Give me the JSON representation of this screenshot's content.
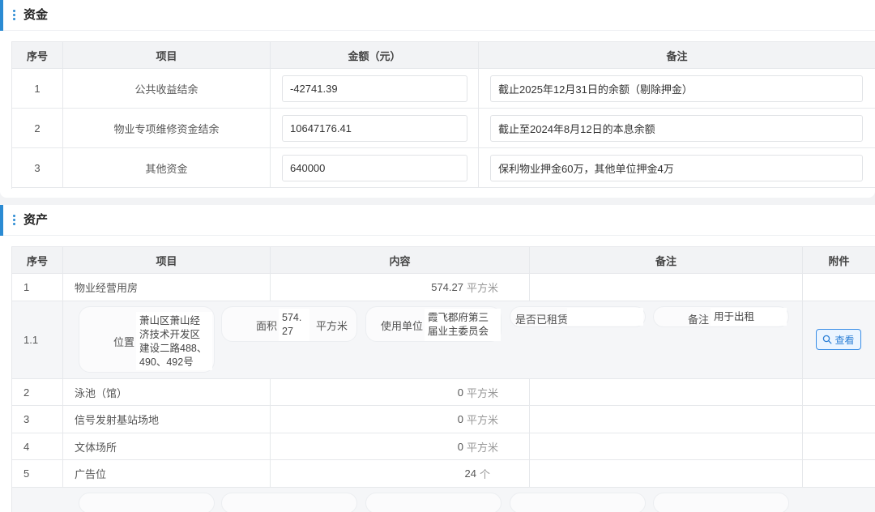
{
  "funds": {
    "title": "资金",
    "headers": [
      "序号",
      "项目",
      "金额（元）",
      "备注"
    ],
    "rows": [
      {
        "no": "1",
        "item": "公共收益结余",
        "amount": "-42741.39",
        "note": "截止2025年12月31日的余额（剔除押金）"
      },
      {
        "no": "2",
        "item": "物业专项维修资金结余",
        "amount": "10647176.41",
        "note": "截止至2024年8月12日的本息余额"
      },
      {
        "no": "3",
        "item": "其他资金",
        "amount": "640000",
        "note": "保利物业押金60万，其他单位押金4万"
      }
    ]
  },
  "assets": {
    "title": "资产",
    "headers": [
      "序号",
      "项目",
      "内容",
      "备注",
      "附件"
    ],
    "rows": [
      {
        "no": "1",
        "item": "物业经营用房",
        "value": "574.27",
        "unit": "平方米"
      },
      {
        "no": "2",
        "item": "泳池（馆）",
        "value": "0",
        "unit": "平方米"
      },
      {
        "no": "3",
        "item": "信号发射基站场地",
        "value": "0",
        "unit": "平方米"
      },
      {
        "no": "4",
        "item": "文体场所",
        "value": "0",
        "unit": "平方米"
      },
      {
        "no": "5",
        "item": "广告位",
        "value": "24",
        "unit": "个"
      }
    ],
    "detail": {
      "no": "1.1",
      "location_label": "位置",
      "location_value": "萧山区萧山经济技术开发区建设二路488、490、492号",
      "area_label": "面积",
      "area_value": "574.27",
      "area_unit": "平方米",
      "user_label": "使用单位",
      "user_value": "霞飞郡府第三届业主委员会",
      "leased_label": "是否已租赁",
      "leased_value": "",
      "remark_label": "备注",
      "remark_value": "用于出租",
      "view_button": "查看"
    }
  }
}
